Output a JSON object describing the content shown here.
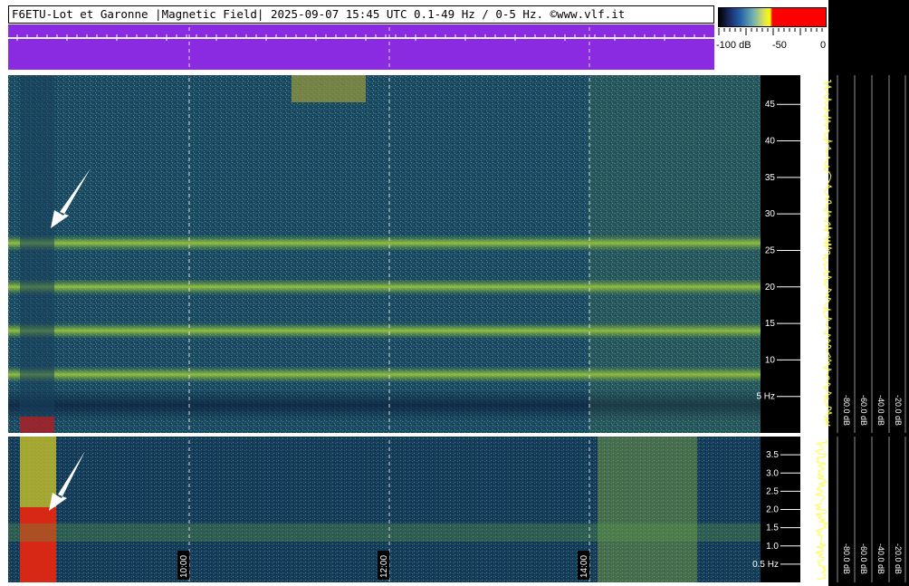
{
  "header": {
    "title": "F6ETU-Lot et Garonne |Magnetic Field| 2025-09-07 15:45 UTC 0.1-49 Hz / 0-5 Hz. ©www.vlf.it"
  },
  "colorbar": {
    "labels": [
      "-100 dB",
      "-50",
      "0"
    ],
    "colors": [
      "#000000",
      "#1b2a66",
      "#2460a8",
      "#d8e05a",
      "#ffff00",
      "#ff0000"
    ]
  },
  "chart_data": [
    {
      "type": "heatmap",
      "name": "upper spectrogram 0.1-49 Hz",
      "title": "",
      "ylabel": "",
      "y_ticks": [
        "45",
        "40",
        "35",
        "30",
        "25",
        "20",
        "15",
        "10",
        "5 Hz"
      ],
      "y_tick_values": [
        45,
        40,
        35,
        30,
        25,
        20,
        15,
        10,
        5
      ],
      "ylim": [
        0,
        49
      ],
      "bands_hz": [
        8,
        14,
        20,
        26
      ],
      "side_axis_ticks": [
        "-80.0 dB",
        "-60.0 dB",
        "-40.0 dB",
        "-20.0 dB"
      ]
    },
    {
      "type": "heatmap",
      "name": "lower spectrogram 0-5 Hz",
      "title": "",
      "ylabel": "",
      "y_ticks": [
        "3.5",
        "3.0",
        "2.5",
        "2.0",
        "1.5",
        "1.0",
        "0.5 Hz"
      ],
      "y_tick_values": [
        3.5,
        3.0,
        2.5,
        2.0,
        1.5,
        1.0,
        0.5
      ],
      "ylim": [
        0,
        4
      ],
      "x_ticks": [
        "10:00",
        "12:00",
        "14:00"
      ],
      "side_axis_ticks": [
        "-80.0 dB",
        "-60.0 dB",
        "-40.0 dB",
        "-20.0 dB"
      ]
    }
  ]
}
